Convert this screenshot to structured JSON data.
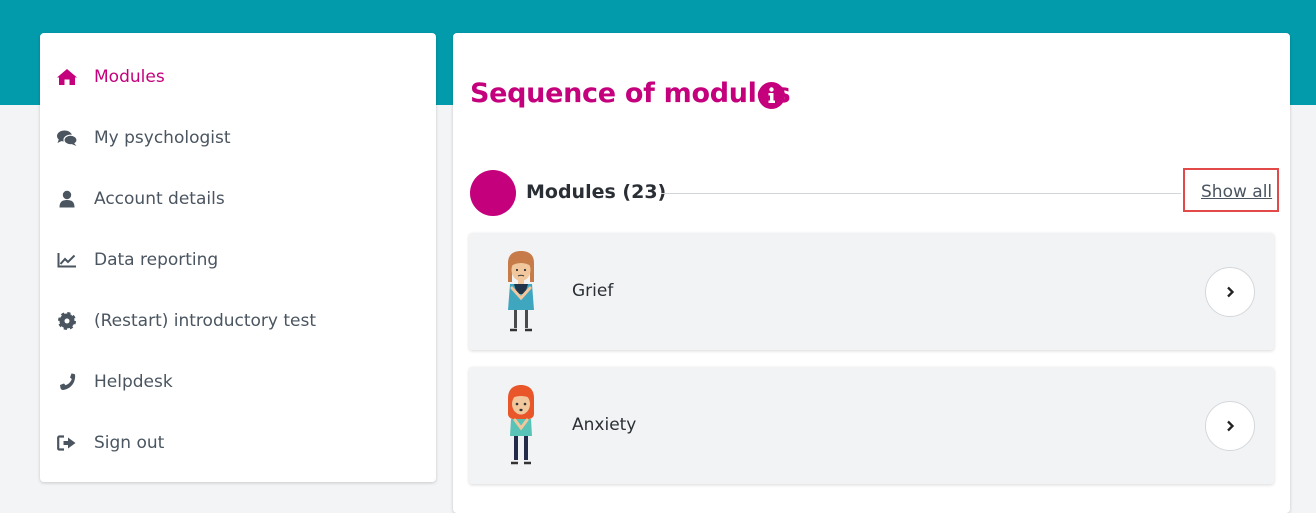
{
  "sidebar": {
    "items": [
      {
        "label": "Modules",
        "icon": "home-icon",
        "active": true
      },
      {
        "label": "My psychologist",
        "icon": "chat-icon"
      },
      {
        "label": "Account details",
        "icon": "user-icon"
      },
      {
        "label": "Data reporting",
        "icon": "line-chart-icon"
      },
      {
        "label": "(Restart) introductory test",
        "icon": "gear-icon"
      },
      {
        "label": "Helpdesk",
        "icon": "phone-icon"
      },
      {
        "label": "Sign out",
        "icon": "sign-out-icon"
      }
    ]
  },
  "main": {
    "title": "Sequence of modules",
    "section": {
      "title": "Modules (23)",
      "show_all": "Show all"
    },
    "modules": [
      {
        "name": "Grief",
        "illustration": "person-illustration"
      },
      {
        "name": "Anxiety",
        "illustration": "person-illustration"
      }
    ]
  },
  "colors": {
    "accent": "#c4007c",
    "header": "#019bab",
    "background": "#f3f4f5",
    "highlight": "#e24a4a"
  }
}
